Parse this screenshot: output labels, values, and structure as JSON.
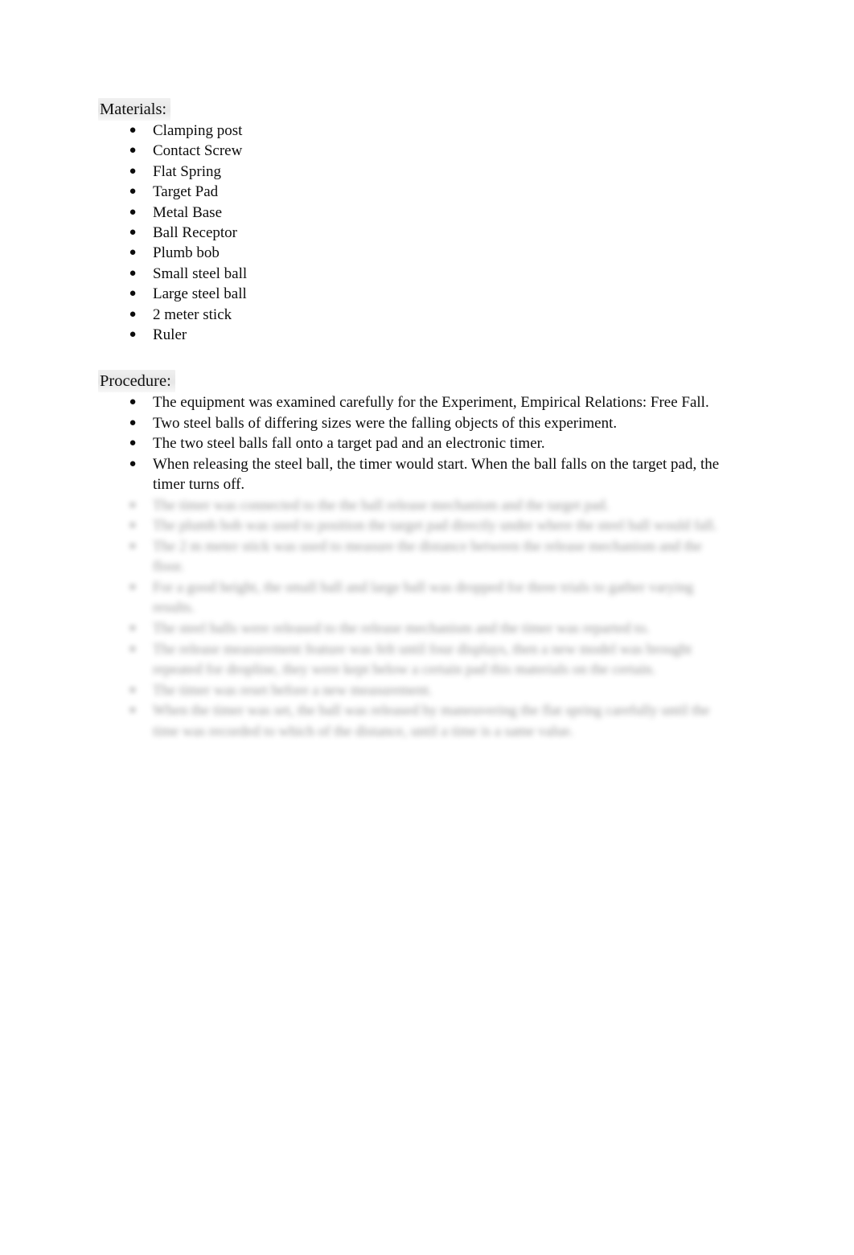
{
  "document": {
    "background_color": "#ffffff",
    "text_color": "#0d0d0d",
    "heading_highlight_color": "#e2e2e2",
    "bullet_glyph": "●"
  },
  "materials": {
    "heading": "Materials:",
    "items": [
      "Clamping post",
      "Contact Screw",
      "Flat Spring",
      "Target Pad",
      "Metal Base",
      "Ball Receptor",
      "Plumb bob",
      "Small steel ball",
      "Large steel ball",
      "2 meter stick",
      "Ruler"
    ]
  },
  "procedure": {
    "heading": "Procedure:",
    "items": [
      "The equipment was examined carefully for the Experiment, Empirical Relations: Free Fall.",
      "Two steel balls of differing sizes were the falling objects of this experiment.",
      "The two steel balls fall onto a target pad and an electronic timer.",
      "When releasing the steel ball, the timer would start. When the ball falls on the target pad, the timer turns off."
    ],
    "blurred_items": [
      "The timer was connected to the the ball release mechanism and the target pad.",
      "The plumb bob was used to position the target pad directly under where the steel ball would fall.",
      "The 2 m meter stick was used to measure the distance between the release mechanism and the floor.",
      "For a good height, the small ball and large ball was dropped for three trials to gather varying results.",
      "The steel balls were released to the release mechanism and the timer was reparted to.",
      "The release measurement feature was felt until four displays, then a new model was brought repeated for dropline, they were kept below a certain pad this materials on the certain.",
      "The timer was reset before a new measurement.",
      "When the timer was set, the ball was released by maneuvering the flat spring carefully until the time was recorded to which of the distance, until a time is a same value."
    ],
    "blurred_note": "illegible-redacted-text"
  }
}
